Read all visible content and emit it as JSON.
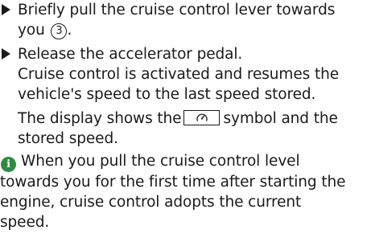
{
  "step1": {
    "line1": "Briefly pull the cruise control lever towards",
    "line2_text": "you",
    "callout_number": "3",
    "line2_end": "."
  },
  "step2": {
    "line1": "Release the accelerator pedal.",
    "result_line1": "Cruise control is activated and resumes the",
    "result_line2": "vehicle's speed to the last speed stored.",
    "display_pre": "The display shows the",
    "display_post": "symbol and the",
    "display_line2": "stored speed."
  },
  "symbol_icon": "cruise-control-icon",
  "note": {
    "icon": "info-icon",
    "icon_glyph": "i",
    "icon_color": "#2e8a3e",
    "line1": "When you pull the cruise control level",
    "line2": "towards you for the first time after starting the",
    "line3": "engine, cruise control adopts the current",
    "line4": "speed."
  }
}
